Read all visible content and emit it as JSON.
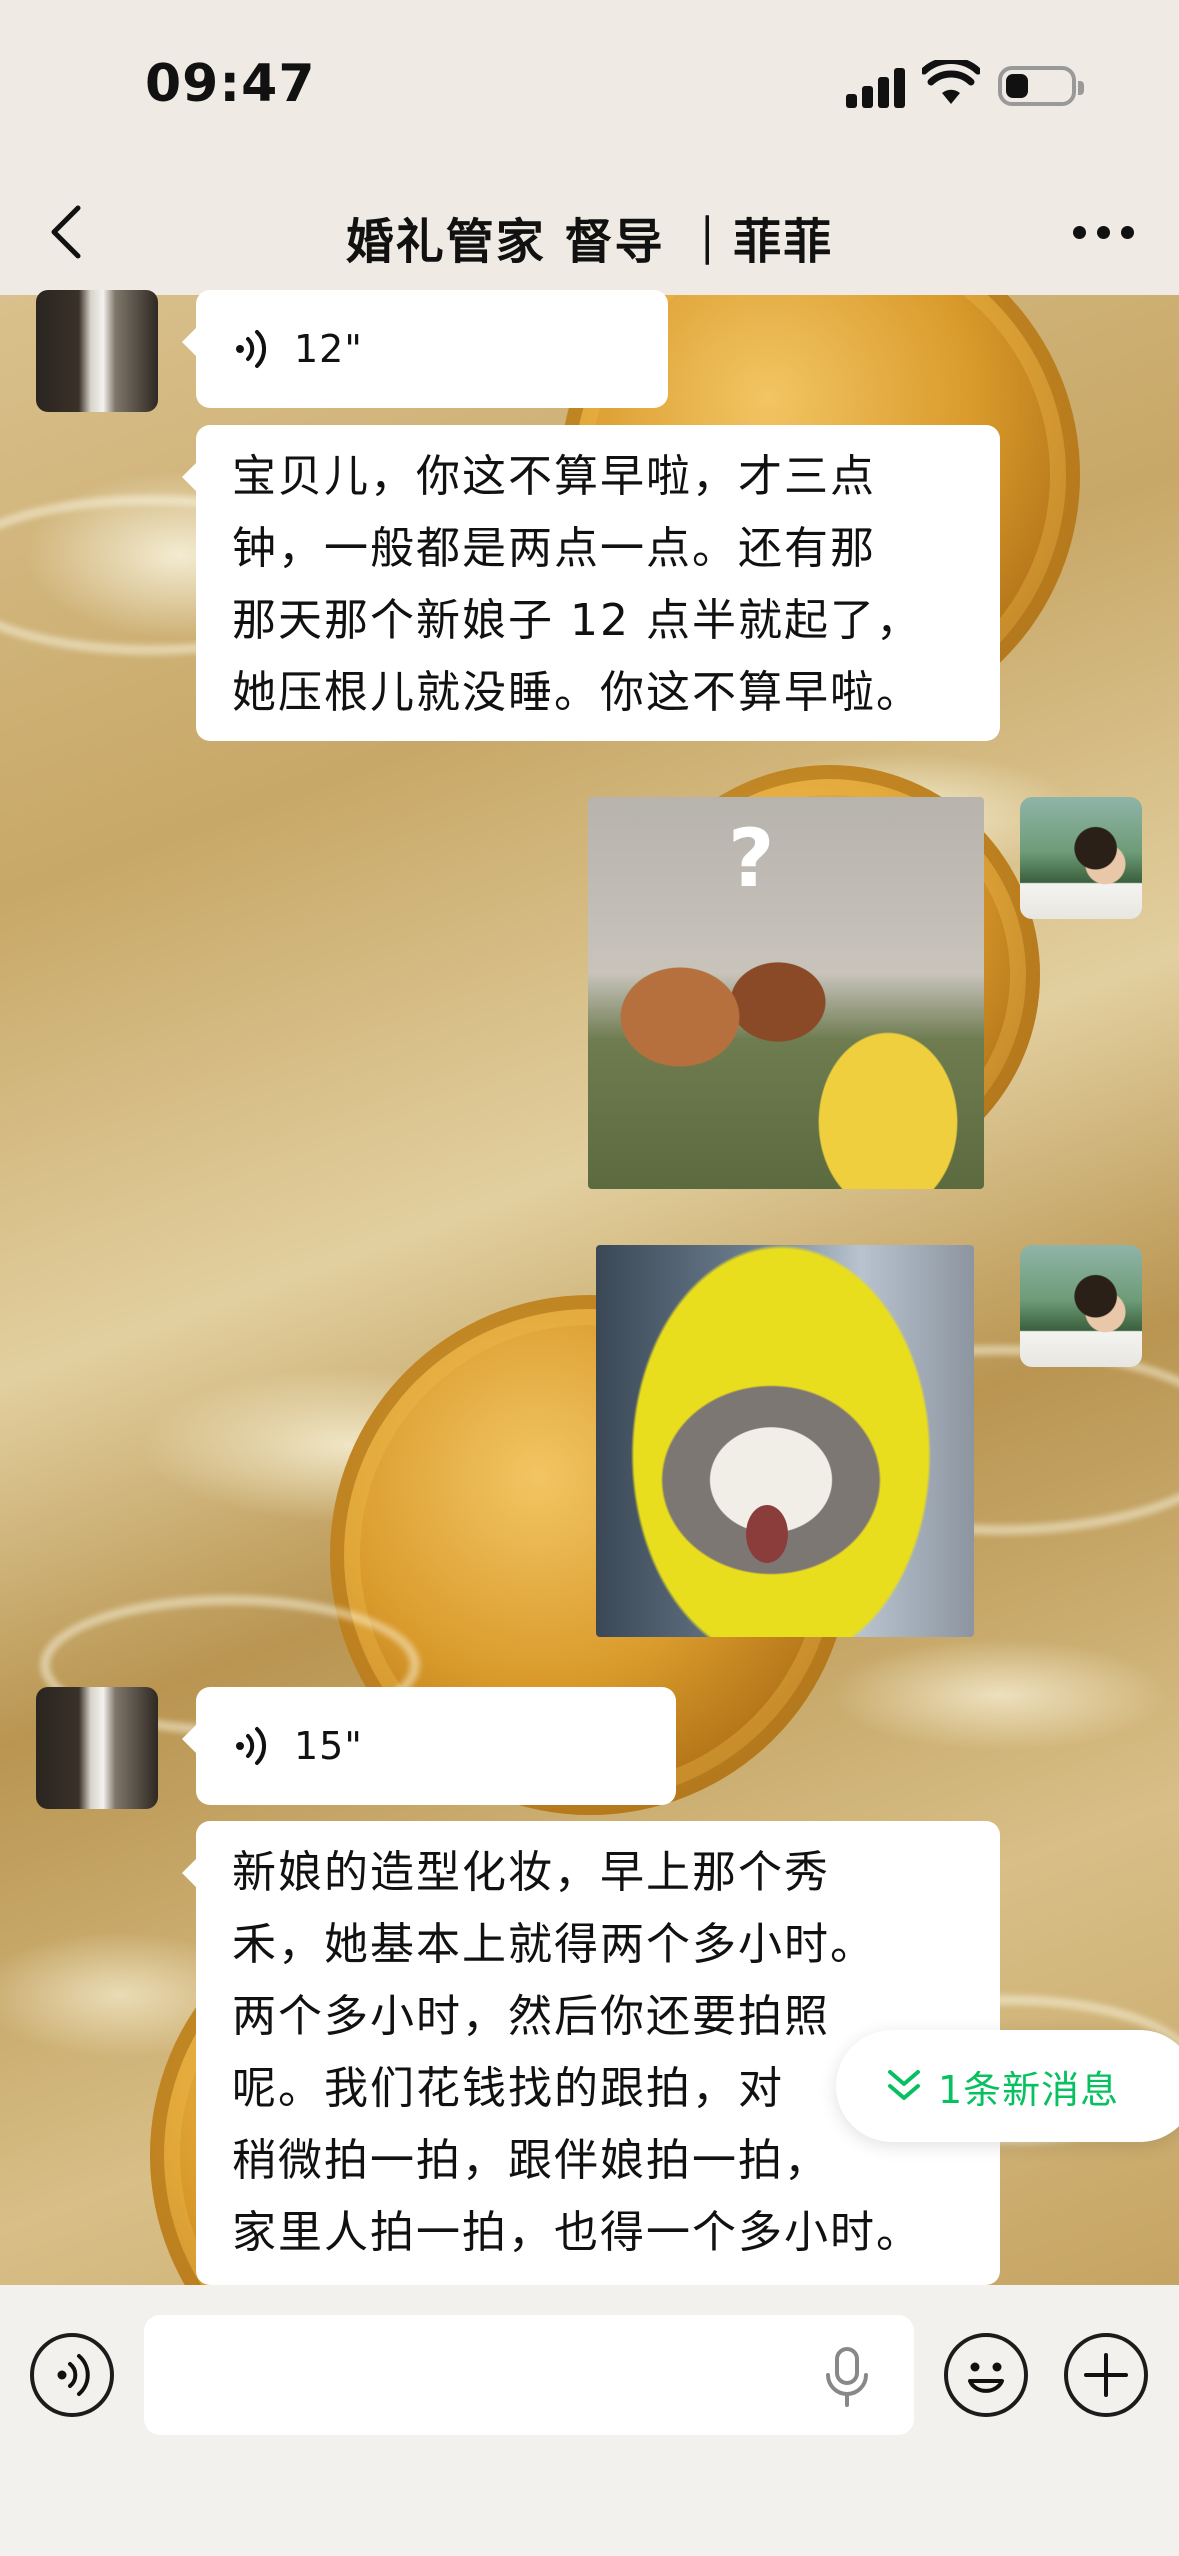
{
  "status_bar": {
    "time": "09:47",
    "battery_level": 0.35
  },
  "nav": {
    "title": "婚礼管家 督导 ｜菲菲",
    "back_icon": "chevron-left-icon",
    "more_icon": "more-dots-icon"
  },
  "messages": [
    {
      "sender": "other",
      "type": "voice",
      "duration": "12\""
    },
    {
      "sender": "other",
      "type": "text",
      "lines": [
        "宝贝儿，你这不算早啦，才三点",
        "钟，一般都是两点一点。还有那",
        "那天那个新娘子 12 点半就起了，",
        "她压根儿就没睡。你这不算早啦。"
      ]
    },
    {
      "sender": "self",
      "type": "sticker",
      "sticker_text": "?"
    },
    {
      "sender": "self",
      "type": "sticker"
    },
    {
      "sender": "other",
      "type": "voice",
      "duration": "15\""
    },
    {
      "sender": "other",
      "type": "text",
      "lines": [
        "新娘的造型化妆，早上那个秀",
        "禾，她基本上就得两个多小时。",
        "两个多小时，然后你还要拍照",
        "呢。我们花钱找的跟拍，对",
        "稍微拍一拍，跟伴娘拍一拍，",
        "家里人拍一拍，也得一个多小时。"
      ]
    }
  ],
  "new_message_pill": {
    "label": "1条新消息",
    "color": "#07c160",
    "icon": "double-chevron-down-icon"
  },
  "input_bar": {
    "value": "",
    "voice_icon": "voice-mode-icon",
    "mic_icon": "microphone-icon",
    "emoji_icon": "emoji-icon",
    "plus_icon": "plus-icon"
  }
}
